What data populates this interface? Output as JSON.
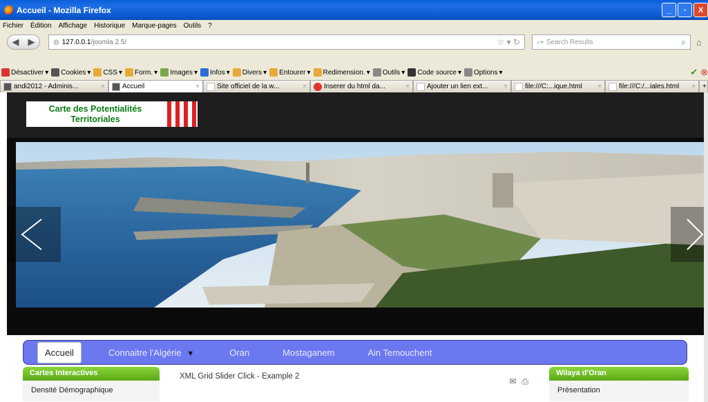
{
  "window": {
    "title": "Accueil - Mozilla Firefox",
    "controls": {
      "minimize": "_",
      "maximize": "▫",
      "close": "X"
    }
  },
  "menu": [
    "Fichier",
    "Édition",
    "Affichage",
    "Historique",
    "Marque-pages",
    "Outils",
    "?"
  ],
  "nav": {
    "url_host": "127.0.0.1",
    "url_path": "/joomla 2.5/",
    "search_placeholder": "Search Results"
  },
  "devtoolbar": [
    {
      "label": "Désactiver",
      "icon": "disable-icon",
      "color": "#d33"
    },
    {
      "label": "Cookies",
      "icon": "cookie-icon",
      "color": "#555"
    },
    {
      "label": "CSS",
      "icon": "css-icon",
      "color": "#e8a93a"
    },
    {
      "label": "Form.",
      "icon": "form-icon",
      "color": "#e8a93a"
    },
    {
      "label": "Images",
      "icon": "images-icon",
      "color": "#7aa84a"
    },
    {
      "label": "Infos",
      "icon": "info-icon",
      "color": "#2a6bd6"
    },
    {
      "label": "Divers",
      "icon": "misc-icon",
      "color": "#e8a93a"
    },
    {
      "label": "Entourer",
      "icon": "outline-icon",
      "color": "#e8a93a"
    },
    {
      "label": "Redimension.",
      "icon": "resize-icon",
      "color": "#e8a93a"
    },
    {
      "label": "Outils",
      "icon": "tools-icon",
      "color": "#888"
    },
    {
      "label": "Code source",
      "icon": "source-icon",
      "color": "#333"
    },
    {
      "label": "Options",
      "icon": "options-icon",
      "color": "#888"
    }
  ],
  "tabs": [
    {
      "label": "andi2012 - Adminis...",
      "icon": "joomla-icon",
      "active": false
    },
    {
      "label": "Accueil",
      "icon": "joomla-icon",
      "active": true
    },
    {
      "label": "Site officiel de la w...",
      "icon": "page-icon",
      "active": false
    },
    {
      "label": "Inserer du html da...",
      "icon": "stop-icon",
      "active": false
    },
    {
      "label": "Ajouter un lien ext...",
      "icon": "page-icon",
      "active": false
    },
    {
      "label": "file:///C:...ique.html",
      "icon": "page-icon",
      "active": false
    },
    {
      "label": "file:///C:/...iales.html",
      "icon": "page-icon",
      "active": false
    }
  ],
  "site": {
    "logo_text": "Carte des Potentialités Territoriales",
    "menu": [
      {
        "label": "Accueil",
        "active": true
      },
      {
        "label": "Connaitre l'Algérie",
        "active": false,
        "dropdown": true
      },
      {
        "label": "Oran",
        "active": false
      },
      {
        "label": "Mostaganem",
        "active": false
      },
      {
        "label": "Ain Temouchent",
        "active": false
      }
    ],
    "left_box": {
      "title": "Cartes Interactives",
      "item": "Densité Démographique"
    },
    "center_title": "XML Grid Slider Click - Example 2",
    "right_box": {
      "title": "Wilaya d'Oran",
      "item": "Présentation"
    }
  },
  "colors": {
    "titlebar": "#0b58cf",
    "site_header": "#1e1e1e",
    "nav_menu": "#6c78f0",
    "box_header": "#6dbb25",
    "logo_text": "#0b7a12"
  }
}
